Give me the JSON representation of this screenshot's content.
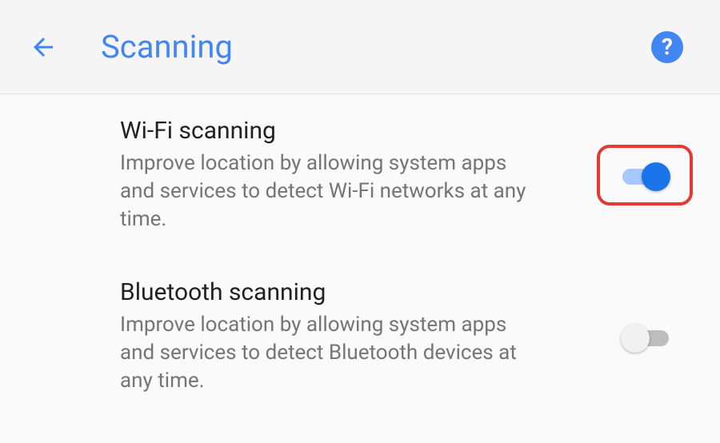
{
  "header": {
    "title": "Scanning"
  },
  "settings": {
    "wifi": {
      "title": "Wi-Fi scanning",
      "description": "Improve location by allowing system apps and services to detect Wi-Fi networks at any time.",
      "enabled": true,
      "highlighted": true
    },
    "bluetooth": {
      "title": "Bluetooth scanning",
      "description": "Improve location by allowing system apps and services to detect Bluetooth devices at any time.",
      "enabled": false,
      "highlighted": false
    }
  },
  "colors": {
    "accent": "#4285f4",
    "highlight": "#e53935"
  }
}
